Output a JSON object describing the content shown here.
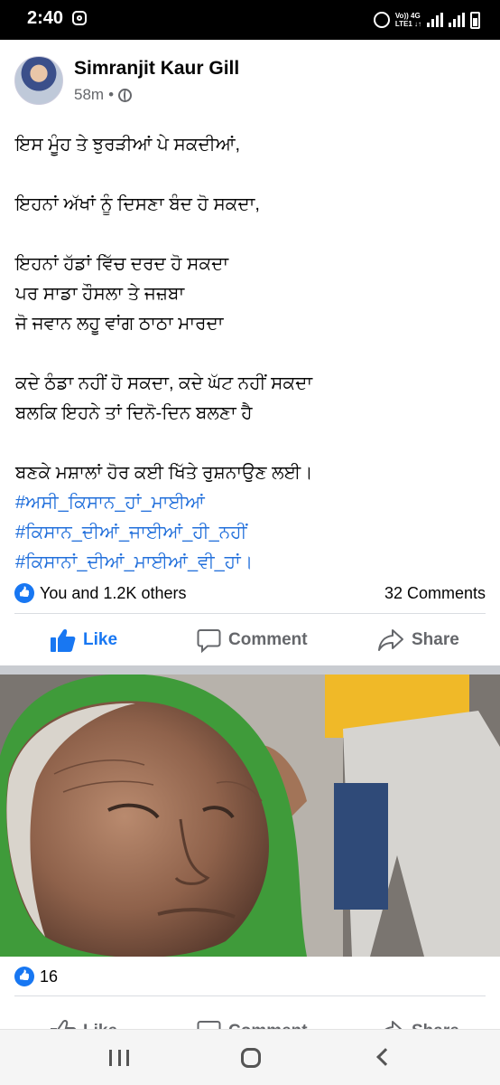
{
  "status_bar": {
    "time": "2:40",
    "network_line1": "Vo)) 4G",
    "network_line2": "LTE1 ↓↑"
  },
  "post": {
    "author": "Simranjit Kaur Gill",
    "time_ago": "58m",
    "separator": "•",
    "lines": [
      "ਇਸ ਮੂੰਹ ਤੇ ਝੁਰੜੀਆਂ ਪੇ ਸਕਦੀਆਂ,",
      "ਇਹਨਾਂ ਅੱਖਾਂ ਨੂੰ ਦਿਸਣਾ ਬੰਦ ਹੋ ਸਕਦਾ,",
      "ਇਹਨਾਂ ਹੱਡਾਂ ਵਿੱਚ ਦਰਦ ਹੋ ਸਕਦਾ",
      "ਪਰ ਸਾਡਾ ਹੌਸਲਾ ਤੇ ਜਜ਼ਬਾ",
      "ਜੋ ਜਵਾਨ ਲਹੂ ਵਾਂਗ ਠਾਠਾ ਮਾਰਦਾ",
      "ਕਦੇ ਠੰਡਾ ਨਹੀਂ ਹੋ ਸਕਦਾ, ਕਦੇ ਘੱਟ ਨਹੀਂ ਸਕਦਾ",
      "ਬਲਕਿ ਇਹਨੇ ਤਾਂ ਦਿਨੋ-ਦਿਨ ਬਲਣਾ ਹੈ",
      "ਬਣਕੇ ਮਸ਼ਾਲਾਂ ਹੋਰ ਕਈ ਖਿੱਤੇ ਰੁਸ਼ਨਾਉਣ  ਲਈ।"
    ],
    "hashtags": [
      "#ਅਸੀ_ਕਿਸਾਨ_ਹਾਂ_ਮਾਈਆਂ",
      "#ਕਿਸਾਨ_ਦੀਆਂ_ਜਾਈਆਂ_ਹੀ_ਨਹੀਂ",
      "#ਕਿਸਾਨਾਂ_ਦੀਆਂ_ਮਾਈਆਂ_ਵੀ_ਹਾਂ।"
    ],
    "reactions_text": "You and 1.2K others",
    "comments_text": "32 Comments"
  },
  "actions": {
    "like": "Like",
    "comment": "Comment",
    "share": "Share"
  },
  "photo_post": {
    "reaction_count": "16"
  },
  "colors": {
    "facebook_blue": "#1877f2",
    "hashtag_blue": "#216fdb",
    "muted_text": "#65676b"
  },
  "icons": [
    "instagram-icon",
    "alarm-icon",
    "signal-icon",
    "battery-icon",
    "globe-icon",
    "like-icon",
    "comment-icon",
    "share-icon",
    "recents-icon",
    "home-icon",
    "back-icon"
  ]
}
